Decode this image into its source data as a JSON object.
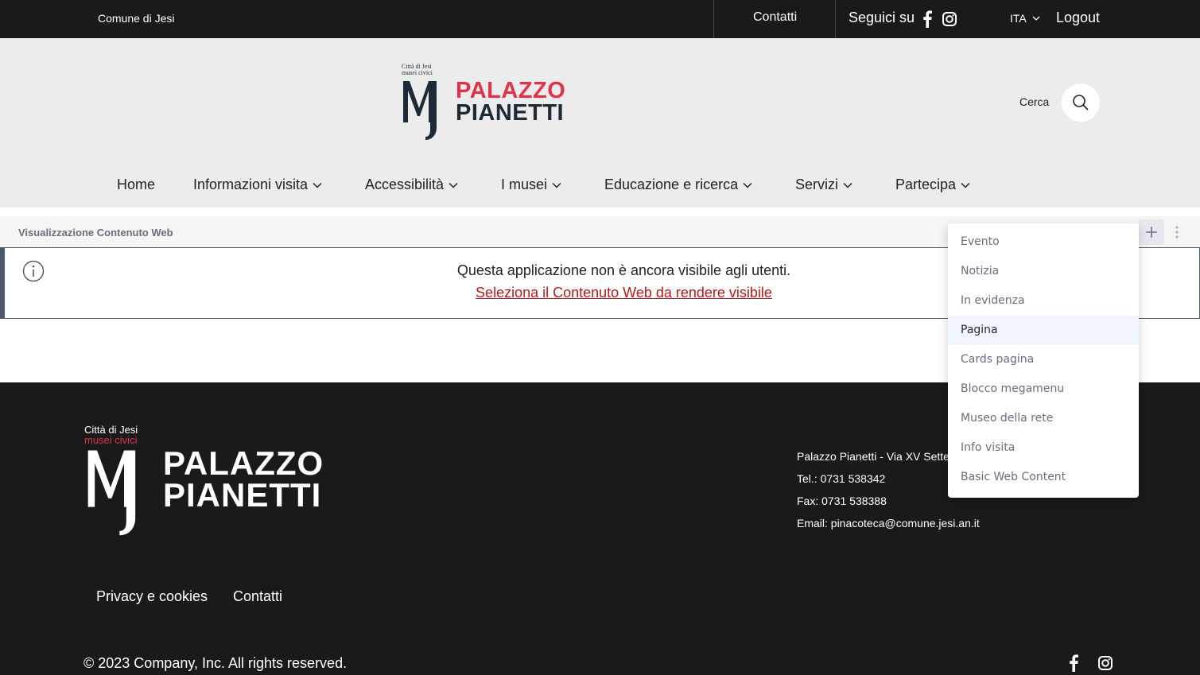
{
  "topbar": {
    "city": "Comune di Jesi",
    "contacts": "Contatti",
    "follow": "Seguici su",
    "language": "ITA",
    "logout": "Logout"
  },
  "header": {
    "logo": {
      "small_line1": "Città di Jesi",
      "small_line2": "musei civici",
      "line1": "PALAZZO",
      "line2": "PIANETTI"
    },
    "search_label": "Cerca"
  },
  "nav": [
    {
      "label": "Home"
    },
    {
      "label": "Informazioni visita"
    },
    {
      "label": "Accessibilità"
    },
    {
      "label": "I musei"
    },
    {
      "label": "Educazione e ricerca"
    },
    {
      "label": "Servizi"
    },
    {
      "label": "Partecipa"
    }
  ],
  "portlet": {
    "title": "Visualizzazione Contenuto Web"
  },
  "alert": {
    "message": "Questa applicazione non è ancora visibile agli utenti.",
    "link": "Seleziona il Contenuto Web da rendere visibile"
  },
  "dropdown": {
    "items": [
      {
        "label": "Evento"
      },
      {
        "label": "Notizia"
      },
      {
        "label": "In evidenza"
      },
      {
        "label": "Pagina"
      },
      {
        "label": "Cards pagina"
      },
      {
        "label": "Blocco megamenu"
      },
      {
        "label": "Museo della rete"
      },
      {
        "label": "Info visita"
      },
      {
        "label": "Basic Web Content"
      }
    ],
    "active_index": 3
  },
  "footer": {
    "logo": {
      "small_line1": "Città di Jesi",
      "small_line2": "musei civici",
      "line1": "PALAZZO",
      "line2": "PIANETTI"
    },
    "address": "Palazzo Pianetti - Via XV Settembre, 10",
    "tel": "Tel.: 0731 538342",
    "fax": "Fax: 0731 538388",
    "email": "Email: pinacoteca@comune.jesi.an.it",
    "links": [
      {
        "label": "Privacy e cookies"
      },
      {
        "label": "Contatti"
      }
    ],
    "copyright": "© 2023 Company, Inc. All rights reserved."
  },
  "colors": {
    "accent": "#e0334a",
    "dark": "#1a1a1a",
    "link": "#b01c1c"
  }
}
